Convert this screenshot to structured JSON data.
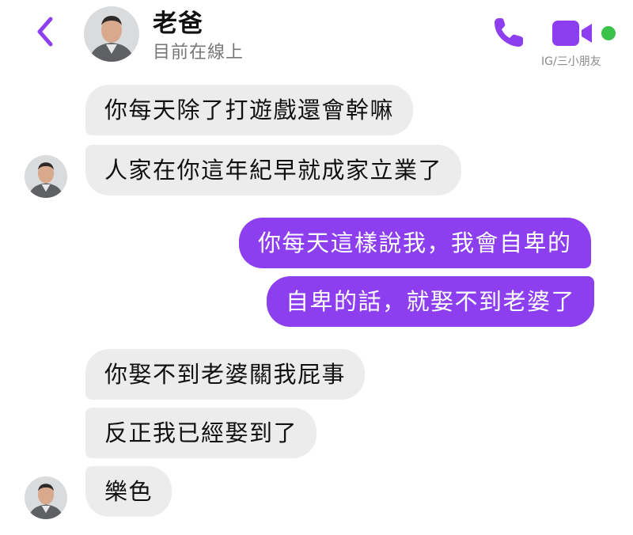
{
  "header": {
    "contact_name": "老爸",
    "status": "目前在線上",
    "watermark": "IG/三小朋友",
    "back_icon": "chevron-left-icon",
    "call_icon": "phone-icon",
    "video_icon": "video-camera-icon",
    "online_indicator_color": "#3bc24a"
  },
  "colors": {
    "accent": "#8d3ff0",
    "received_bubble": "#ececec",
    "received_text": "#111111",
    "sent_text": "#ffffff"
  },
  "messages": [
    {
      "sender": "them",
      "text": "你每天除了打遊戲還會幹嘛"
    },
    {
      "sender": "them",
      "text": "人家在你這年紀早就成家立業了"
    },
    {
      "sender": "me",
      "text": "你每天這樣說我，我會自卑的"
    },
    {
      "sender": "me",
      "text": "自卑的話，就娶不到老婆了"
    },
    {
      "sender": "them",
      "text": "你娶不到老婆關我屁事"
    },
    {
      "sender": "them",
      "text": "反正我已經娶到了"
    },
    {
      "sender": "them",
      "text": "樂色"
    }
  ]
}
